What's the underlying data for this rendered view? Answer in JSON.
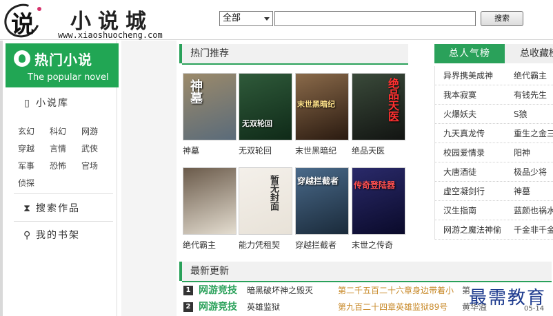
{
  "header": {
    "logo_calli": "说",
    "site_name": "小说城",
    "site_url": "www.xiaoshuocheng.com",
    "search": {
      "category_selected": "全部",
      "input_value": "",
      "button_label": "搜索"
    }
  },
  "sidebar": {
    "banner_title": "热门小说",
    "banner_subtitle": "The popular novel",
    "library_label": "小说库",
    "genres": [
      "玄幻",
      "科幻",
      "网游",
      "穿越",
      "言情",
      "武侠",
      "军事",
      "恐怖",
      "官场",
      "侦探"
    ],
    "search_works_label": "搜索作品",
    "bookshelf_label": "我的书架"
  },
  "hot": {
    "title": "热门推荐",
    "books": [
      {
        "name": "神墓",
        "cover_text": "神墓",
        "color1": "#9c8a6a",
        "color2": "#5a6b7a"
      },
      {
        "name": "无双轮回",
        "cover_text": "无双轮回",
        "color1": "#2f5a3a",
        "color2": "#0f2a18"
      },
      {
        "name": "末世黑暗纪",
        "cover_text": "末世黑暗纪",
        "color1": "#8a6a4a",
        "color2": "#2a1a10"
      },
      {
        "name": "绝品天医",
        "cover_text": "绝品天医",
        "color1": "#3a4a3a",
        "color2": "#121412"
      },
      {
        "name": "绝代霸主",
        "cover_text": "",
        "color1": "#6a5a4a",
        "color2": "#e4ddd0"
      },
      {
        "name": "能力凭租契",
        "cover_text": "暂无封面",
        "color1": "#f4f0ea",
        "color2": "#e8e2d8"
      },
      {
        "name": "穿越拦截者",
        "cover_text": "穿越拦截者",
        "color1": "#4a6a8a",
        "color2": "#1a2a3a"
      },
      {
        "name": "末世之传奇",
        "cover_text": "传奇登陆器",
        "color1": "#2a2a6a",
        "color2": "#0a0a2a"
      }
    ]
  },
  "ranking": {
    "tab_total": "总人气榜",
    "tab_fav": "总收藏榜",
    "rows": [
      [
        "异界携美成神",
        "绝代霸主"
      ],
      [
        "我本寂寞",
        "有钱先生"
      ],
      [
        "火爆妖夫",
        "S狼"
      ],
      [
        "九天真龙传",
        "重生之金三"
      ],
      [
        "校园爱情录",
        "阳神"
      ],
      [
        "大唐酒徒",
        "极品少将"
      ],
      [
        "虚空凝剑行",
        "神墓"
      ],
      [
        "汉生指南",
        "蓝颜也祸水"
      ],
      [
        "网游之魔法神偷",
        "千金非千金"
      ]
    ]
  },
  "latest": {
    "title": "最新更新",
    "rows": [
      {
        "num": "1",
        "category": "网游竞技",
        "book": "暗黑破坏神之毁灭",
        "chapter": "第二千五百二十六章身边带着小",
        "author": "第",
        "date": ""
      },
      {
        "num": "2",
        "category": "网游竞技",
        "book": "英雄监狱",
        "chapter": "第九百二十四章英雄监狱89号",
        "author": "黄华溢",
        "date": "05-14"
      }
    ]
  },
  "watermark": "最需教育",
  "colors": {
    "accent": "#2aa15a",
    "chapter": "#c88a2a"
  }
}
